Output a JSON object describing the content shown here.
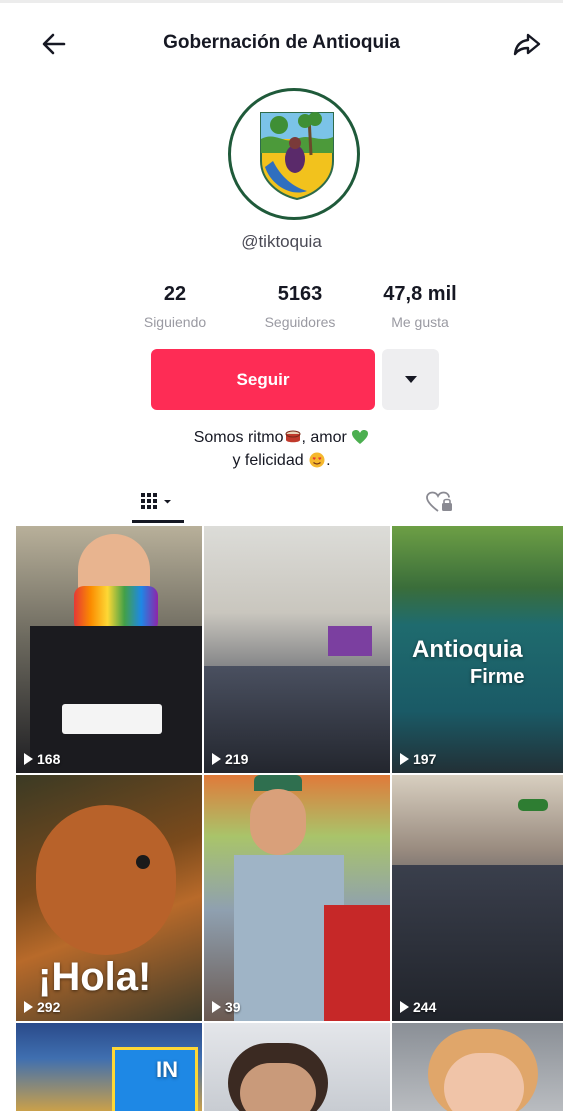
{
  "header": {
    "title": "Gobernación de Antioquia"
  },
  "profile": {
    "username": "@tiktoquia",
    "stats": [
      {
        "value": "22",
        "label": "Siguiendo"
      },
      {
        "value": "5163",
        "label": "Seguidores"
      },
      {
        "value": "47,8 mil",
        "label": "Me gusta"
      }
    ],
    "follow_label": "Seguir",
    "bio_line1_a": "Somos ritmo",
    "bio_line1_b": ", amor",
    "bio_line2": "y felicidad",
    "bio_line2_end": "."
  },
  "videos": [
    {
      "views": "168"
    },
    {
      "views": "219"
    },
    {
      "views": "197",
      "overlay_a": "Antioquia",
      "overlay_b": "Firme"
    },
    {
      "views": "292",
      "overlay": "¡Hola!"
    },
    {
      "views": "39"
    },
    {
      "views": "244"
    },
    {
      "overlay": "IN"
    },
    {},
    {}
  ],
  "colors": {
    "accent": "#fe2c55",
    "avatar_ring": "#1f5a3a"
  }
}
